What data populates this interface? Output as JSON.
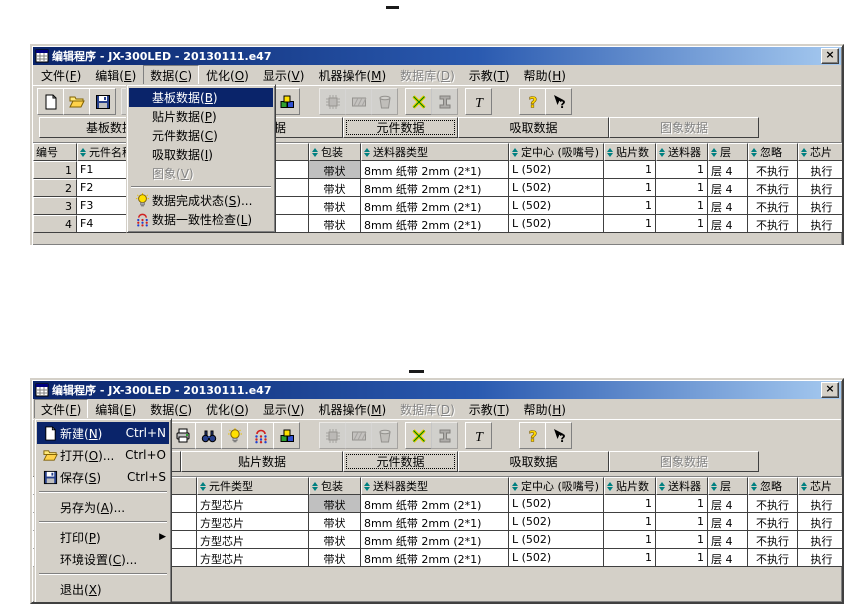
{
  "window": {
    "title": "编辑程序 - JX-300LED - 20130111.e47",
    "close_glyph": "×",
    "menu_bar": [
      {
        "label": "文件(F)"
      },
      {
        "label": "编辑(E)"
      },
      {
        "label": "数据(C)"
      },
      {
        "label": "优化(O)"
      },
      {
        "label": "显示(V)"
      },
      {
        "label": "机器操作(M)"
      },
      {
        "label": "数据库(D)",
        "disabled": true
      },
      {
        "label": "示教(T)"
      },
      {
        "label": "帮助(H)"
      }
    ],
    "toolbar": [
      {
        "icon": "new-icon"
      },
      {
        "icon": "open-icon"
      },
      {
        "icon": "save-icon"
      },
      {
        "icon": "delete-icon",
        "disabled": true
      },
      {
        "icon": "print-icon"
      },
      {
        "icon": "find-icon"
      },
      {
        "icon": "bulb-icon"
      },
      {
        "icon": "consistency-icon"
      },
      {
        "icon": "blocks-icon"
      },
      {
        "icon": "chip-icon",
        "disabled": true
      },
      {
        "icon": "feeder-icon",
        "disabled": true
      },
      {
        "icon": "bin-icon",
        "disabled": true
      },
      {
        "icon": "board-tool-icon"
      },
      {
        "icon": "ibeam-icon",
        "disabled": true
      },
      {
        "icon": "text-icon"
      },
      {
        "icon": "help-icon"
      },
      {
        "icon": "context-help-icon"
      }
    ],
    "tabs": [
      {
        "label": "基板数据"
      },
      {
        "label": "贴片数据"
      },
      {
        "label": "元件数据",
        "selected": true
      },
      {
        "label": "吸取数据"
      },
      {
        "label": "图象数据",
        "disabled": true
      }
    ],
    "table": {
      "headers": [
        {
          "label": "编号"
        },
        {
          "label": "元件名称",
          "sort": true
        },
        {
          "label": "元件类型",
          "sort": true
        },
        {
          "label": "包装",
          "sort": true
        },
        {
          "label": "送料器类型",
          "sort": true
        },
        {
          "label": "定中心 (吸嘴号)",
          "sort": true
        },
        {
          "label": "贴片数",
          "sort": true
        },
        {
          "label": "送料器",
          "sort": true
        },
        {
          "label": "层",
          "sort": true
        },
        {
          "label": "忽略",
          "sort": true
        },
        {
          "label": "芯片",
          "sort": true
        }
      ],
      "rows": [
        [
          "1",
          "F1",
          "方型芯片",
          "带状",
          "8mm 纸带  2mm (2*1)",
          "L (502)",
          "1",
          "1",
          "层 4",
          "不执行",
          "执行"
        ],
        [
          "2",
          "F2",
          "方型芯片",
          "带状",
          "8mm 纸带  2mm (2*1)",
          "L (502)",
          "1",
          "1",
          "层 4",
          "不执行",
          "执行"
        ],
        [
          "3",
          "F3",
          "方型芯片",
          "带状",
          "8mm 纸带  2mm (2*1)",
          "L (502)",
          "1",
          "1",
          "层 4",
          "不执行",
          "执行"
        ],
        [
          "4",
          "F4",
          "方型芯片",
          "带状",
          "8mm 纸带  2mm (2*1)",
          "L (502)",
          "1",
          "1",
          "层 4",
          "不执行",
          "执行"
        ]
      ],
      "selected_cell": {
        "row": 0,
        "col": 3
      }
    }
  },
  "data_menu": {
    "trigger": "数据(C)",
    "items": [
      {
        "label": "基板数据(B)",
        "highlighted": true
      },
      {
        "label": "贴片数据(P)"
      },
      {
        "label": "元件数据(C)"
      },
      {
        "label": "吸取数据(I)"
      },
      {
        "label": "图象(V)",
        "disabled": true
      },
      {
        "sep": true
      },
      {
        "label": "数据完成状态(S)...",
        "icon": "bulb-icon"
      },
      {
        "label": "数据一致性检查(L)",
        "icon": "consistency-icon"
      }
    ]
  },
  "file_menu": {
    "trigger": "文件(F)",
    "items": [
      {
        "label": "新建(N)",
        "shortcut": "Ctrl+N",
        "highlighted": true,
        "icon": "new-icon"
      },
      {
        "label": "打开(O)...",
        "shortcut": "Ctrl+O",
        "icon": "open-icon"
      },
      {
        "label": "保存(S)",
        "shortcut": "Ctrl+S",
        "icon": "save-icon"
      },
      {
        "sep": true
      },
      {
        "label": "另存为(A)..."
      },
      {
        "sep": true
      },
      {
        "label": "打印(P)",
        "submenu": true
      },
      {
        "label": "环境设置(C)..."
      },
      {
        "sep": true
      },
      {
        "label": "退出(X)"
      }
    ]
  },
  "windows": [
    {
      "active_menu_index": 2,
      "open_menu": "data_menu"
    },
    {
      "active_menu_index": 0,
      "open_menu": "file_menu"
    }
  ],
  "colors": {
    "titlebar_left": "#0a246a",
    "titlebar_right": "#a6caf0",
    "chrome": "#d4d0c8",
    "menu_highlight": "#0a246a",
    "sort_arrow": "#008080",
    "selected_cell": "#c0c0c0"
  }
}
